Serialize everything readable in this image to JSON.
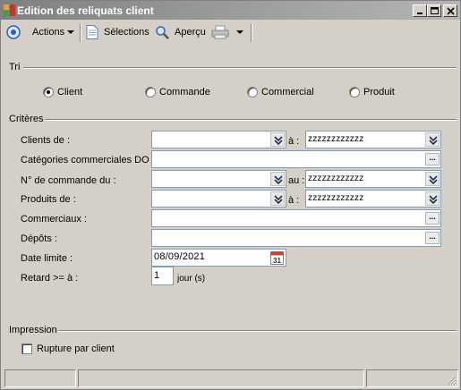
{
  "window": {
    "title": "Edition des reliquats client"
  },
  "toolbar": {
    "actions_label": "Actions",
    "selections_label": "Sélections",
    "apercu_label": "Aperçu"
  },
  "tri": {
    "title": "Tri",
    "options": [
      {
        "label": "Client",
        "selected": true
      },
      {
        "label": "Commande",
        "selected": false
      },
      {
        "label": "Commercial",
        "selected": false
      },
      {
        "label": "Produit",
        "selected": false
      }
    ]
  },
  "criteres": {
    "title": "Critères",
    "clients": {
      "label": "Clients de :",
      "from": "",
      "connector": "à :",
      "to": "zzzzzzzzzzzz"
    },
    "categories": {
      "label": "Catégories commerciales DO :",
      "value": ""
    },
    "commande": {
      "label": "N° de commande du :",
      "from": "",
      "connector": "au :",
      "to": "zzzzzzzzzzzz"
    },
    "produits": {
      "label": "Produits de :",
      "from": "",
      "connector": "à :",
      "to": "zzzzzzzzzzzz"
    },
    "commerciaux": {
      "label": "Commerciaux :",
      "value": ""
    },
    "depots": {
      "label": "Dépôts :",
      "value": ""
    },
    "date_limite": {
      "label": "Date limite :",
      "value": "08/09/2021",
      "calendar_day": "31"
    },
    "retard": {
      "label": "Retard >= à :",
      "value": "1",
      "unit": "jour (s)"
    }
  },
  "impression": {
    "title": "Impression",
    "rupture": {
      "label": "Rupture par client",
      "checked": false
    }
  },
  "icons": {
    "app": "app-icon",
    "minimize": "minimize-icon",
    "maximize": "maximize-icon",
    "close": "close-icon",
    "actions": "target-icon",
    "selections": "document-icon",
    "apercu": "magnifier-icon",
    "print": "printer-icon",
    "combo": "double-chevron-down-icon",
    "calendar": "calendar-icon",
    "grip": "resize-grip-icon"
  }
}
